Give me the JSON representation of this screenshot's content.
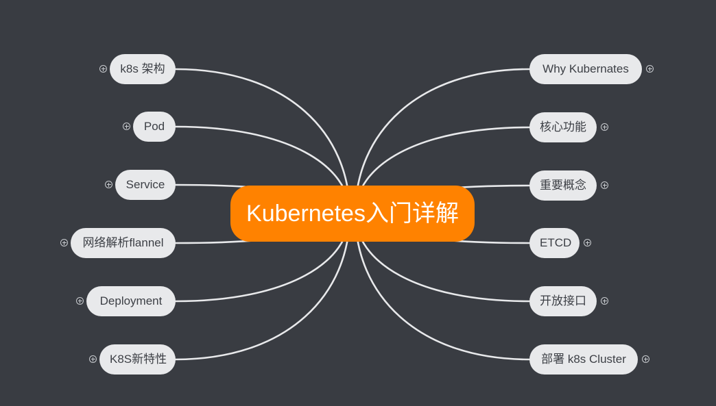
{
  "mindmap": {
    "root": {
      "label": "Kubernetes入门详解",
      "color": "#ff8200"
    },
    "left_branches": [
      {
        "label": "k8s 架构",
        "collapsed": true
      },
      {
        "label": "Pod",
        "collapsed": true
      },
      {
        "label": "Service",
        "collapsed": true
      },
      {
        "label": "网络解析flannel",
        "collapsed": true
      },
      {
        "label": "Deployment",
        "collapsed": true
      },
      {
        "label": "K8S新特性",
        "collapsed": true
      }
    ],
    "right_branches": [
      {
        "label": "Why Kubernates",
        "collapsed": true
      },
      {
        "label": "核心功能",
        "collapsed": true
      },
      {
        "label": "重要概念",
        "collapsed": true
      },
      {
        "label": "ETCD",
        "collapsed": true
      },
      {
        "label": "开放接口",
        "collapsed": true
      },
      {
        "label": "部署 k8s Cluster",
        "collapsed": true
      }
    ],
    "colors": {
      "background": "#393c42",
      "node_fill": "#e8e9eb",
      "node_text": "#3c3f45",
      "connector": "#e8e9eb"
    }
  }
}
